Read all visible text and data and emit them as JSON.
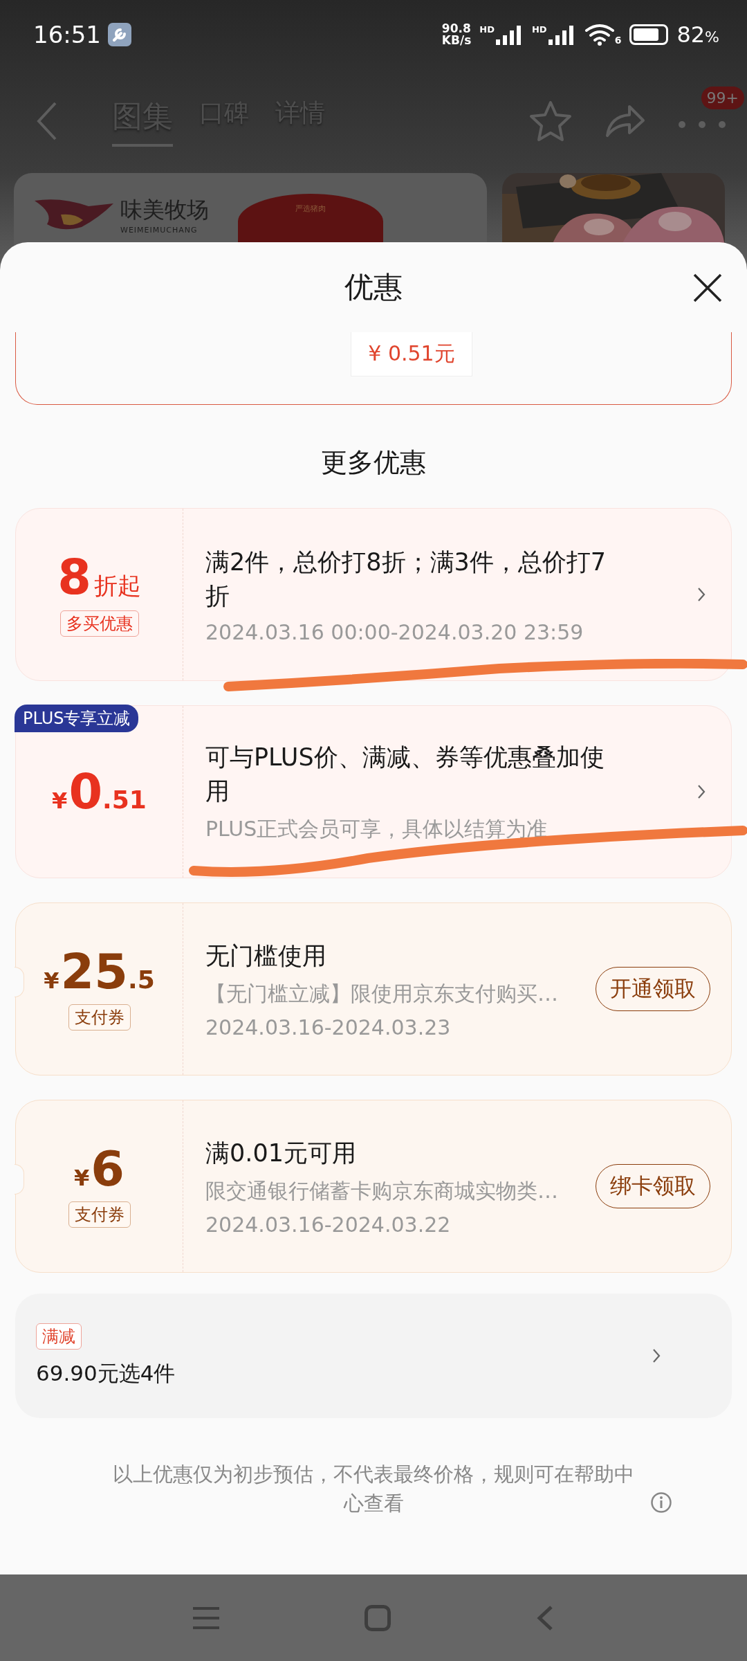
{
  "status_bar": {
    "time": "16:51",
    "net_speed": "90.8",
    "net_unit": "KB/s",
    "signal_labels": [
      "HD",
      "HD"
    ],
    "wifi_badge": "6",
    "battery": "82",
    "battery_unit": "%"
  },
  "nav": {
    "tabs": [
      {
        "label": "图集",
        "selected": true
      },
      {
        "label": "口碑",
        "selected": false
      },
      {
        "label": "详情",
        "selected": false
      }
    ],
    "badge": "99+"
  },
  "banner": {
    "brand": "味美牧场",
    "brand_latin": "WEIMEIMUCHANG",
    "emblem_text": "严选猪肉"
  },
  "sheet": {
    "title": "优惠",
    "top_offer_amount": "¥ 0.51元",
    "section_title": "更多优惠",
    "offers": [
      {
        "kind": "discount",
        "value": "8",
        "unit": "折起",
        "tag": "多买优惠",
        "title": "满2件，总价打8折；满3件，总价打7折",
        "detail": "2024.03.16 00:00-2024.03.20 23:59"
      },
      {
        "kind": "plus",
        "badge": "PLUS专享立减",
        "currency": "¥",
        "value": "0",
        "decimal": ".51",
        "title": "可与PLUS价、满减、券等优惠叠加使用",
        "detail": "PLUS正式会员可享，具体以结算为准"
      },
      {
        "kind": "coupon",
        "currency": "¥",
        "value": "25",
        "decimal": ".5",
        "tag": "支付券",
        "title": "无门槛使用",
        "description": "【无门槛立减】限使用京东支付购买…",
        "detail": "2024.03.16-2024.03.23",
        "action": "开通领取"
      },
      {
        "kind": "coupon",
        "currency": "¥",
        "value": "6",
        "tag": "支付券",
        "title": "满0.01元可用",
        "description": "限交通银行储蓄卡购京东商城实物类…",
        "detail": "2024.03.16-2024.03.22",
        "action": "绑卡领取"
      }
    ],
    "promo": {
      "tag": "满减",
      "text": "69.90元选4件"
    },
    "footnote": "以上优惠仅为初步预估，不代表最终价格，规则可在帮助中心查看"
  }
}
